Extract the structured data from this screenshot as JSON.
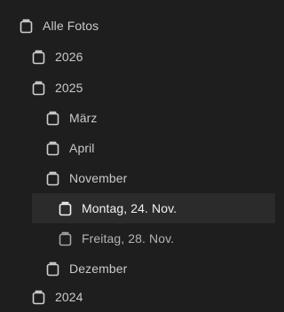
{
  "tree": {
    "root": {
      "label": "Alle Fotos",
      "icon": "folder-icon"
    },
    "year_2026": {
      "label": "2026",
      "icon": "folder-icon"
    },
    "year_2025": {
      "label": "2025",
      "icon": "folder-icon"
    },
    "month_maerz": {
      "label": "März",
      "icon": "folder-icon"
    },
    "month_april": {
      "label": "April",
      "icon": "folder-icon"
    },
    "month_november": {
      "label": "November",
      "icon": "folder-icon"
    },
    "day_montag": {
      "label": "Montag, 24. Nov.",
      "icon": "folder-icon",
      "selected": true
    },
    "day_freitag": {
      "label": "Freitag, 28. Nov.",
      "icon": "folder-icon"
    },
    "month_dezember": {
      "label": "Dezember",
      "icon": "folder-icon"
    },
    "year_2024": {
      "label": "2024",
      "icon": "folder-icon"
    }
  },
  "colors": {
    "background": "#1e1e1e",
    "selection": "#2b2b2b",
    "text": "#c9c9c9",
    "text_selected": "#f2f2f2"
  }
}
